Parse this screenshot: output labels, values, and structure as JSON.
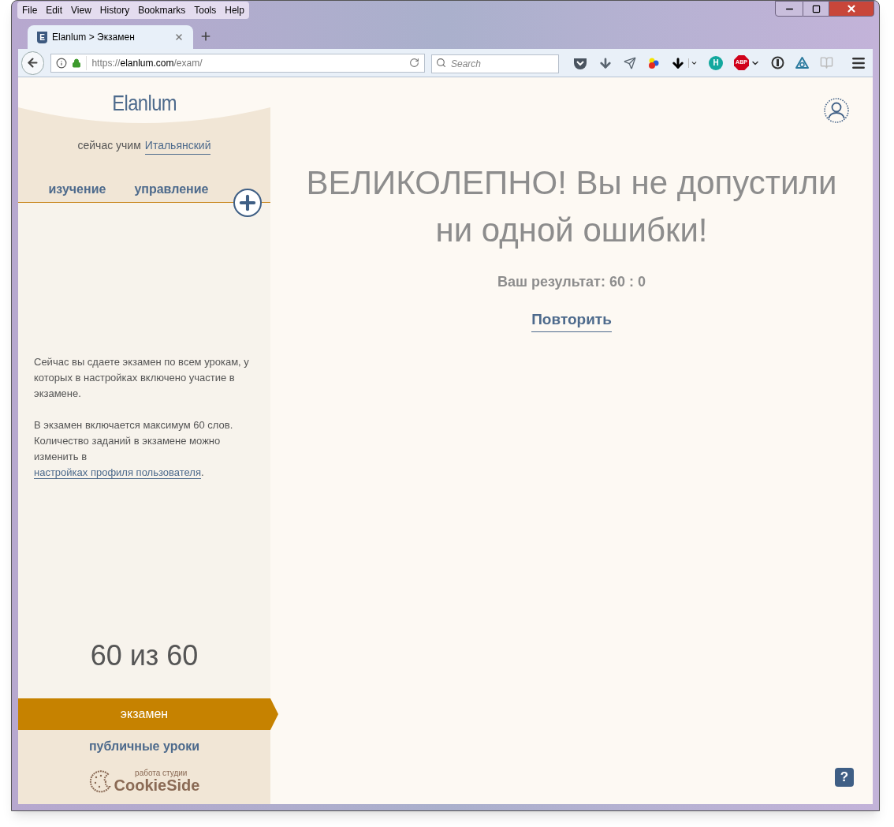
{
  "menu": [
    "File",
    "Edit",
    "View",
    "History",
    "Bookmarks",
    "Tools",
    "Help"
  ],
  "tab": {
    "favicon": "E",
    "title": "Elanlum > Экзамен"
  },
  "address": {
    "scheme": "https://",
    "host": "elanlum.com",
    "path": "/exam/"
  },
  "search": {
    "placeholder": "Search"
  },
  "extensions": {
    "h_badge": "H",
    "abp_badge": "ABP"
  },
  "sidebar": {
    "logo": "Elanlum",
    "learning_prefix": "сейчас учим",
    "language": "Итальянский",
    "tabs": [
      {
        "label": "изучение"
      },
      {
        "label": "управление"
      }
    ],
    "info": [
      {
        "text": "Сейчас вы сдаете экзамен по всем урокам, у которых в настройках включено участие в экзамене."
      },
      {
        "text": "В экзамен включается максимум 60 слов. Количество заданий в экзамене можно изменить в ",
        "link": "настройках профиля пользователя",
        "after": "."
      }
    ],
    "counter": "60 из 60",
    "nav": [
      {
        "label": "экзамен",
        "selected": true
      },
      {
        "label": "публичные уроки",
        "selected": false
      }
    ],
    "credit": {
      "caption": "работа студии",
      "brand": "CookieSide"
    }
  },
  "main": {
    "heading": "ВЕЛИКОЛЕПНО! Вы не допустили ни одной ошибки!",
    "result": "Ваш результат: 60 : 0",
    "retry": "Повторить",
    "help": "?"
  }
}
